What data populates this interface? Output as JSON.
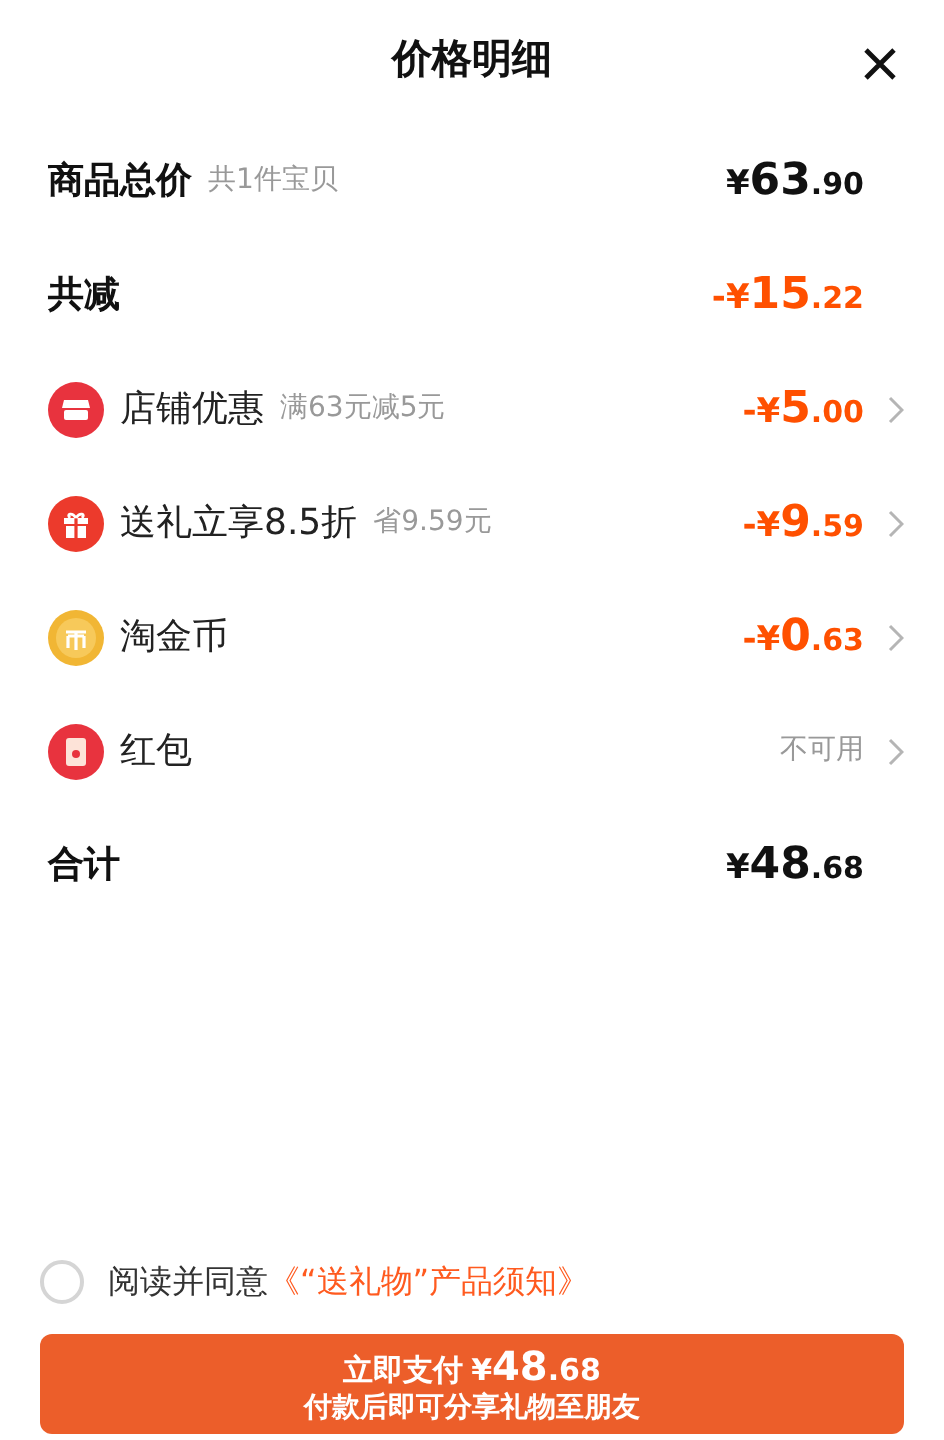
{
  "title": "价格明细",
  "rows": [
    {
      "kind": "total",
      "label": "商品总价",
      "note": "共1件宝贝",
      "price": {
        "prefix": "¥",
        "integer": "63",
        "decimal": ".90"
      }
    },
    {
      "kind": "reduction",
      "label": "共减",
      "price": {
        "prefix": "-¥",
        "integer": "15",
        "decimal": ".22"
      }
    },
    {
      "kind": "shop",
      "label": "店铺优惠",
      "note": "满63元减5元",
      "price": {
        "prefix": "-¥",
        "integer": "5",
        "decimal": ".00"
      }
    },
    {
      "kind": "gift",
      "label": "送礼立享8.5折",
      "note": "省9.59元",
      "price": {
        "prefix": "-¥",
        "integer": "9",
        "decimal": ".59"
      }
    },
    {
      "kind": "coin",
      "label": "淘金币",
      "price": {
        "prefix": "-¥",
        "integer": "0",
        "decimal": ".63"
      }
    },
    {
      "kind": "packet",
      "label": "红包",
      "status": "不可用"
    },
    {
      "kind": "total",
      "label": "合计",
      "price": {
        "prefix": "¥",
        "integer": "48",
        "decimal": ".68"
      }
    }
  ],
  "agreement": {
    "checked": false,
    "text": "阅读并同意",
    "link": "《“送礼物”产品须知》"
  },
  "pay_button": {
    "label": "立即支付",
    "price": {
      "prefix": "¥",
      "integer": "48",
      "decimal": ".68"
    },
    "subtitle": "付款后即可分享礼物至朋友"
  }
}
